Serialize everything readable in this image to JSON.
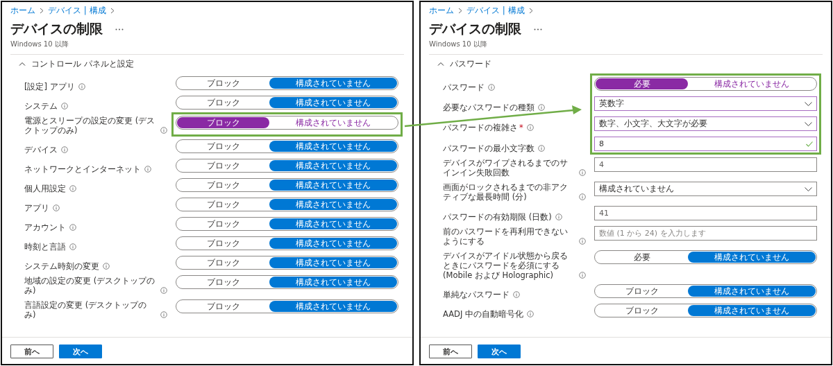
{
  "panels": [
    {
      "breadcrumb": [
        "ホーム",
        "デバイス | 構成"
      ],
      "title": "デバイスの制限",
      "subtitle": "Windows 10 以降",
      "section": {
        "label": "コントロール パネルと設定",
        "expanded": true
      },
      "settings": [
        {
          "kind": "toggle",
          "label": "[設定] アプリ",
          "highlighted": false,
          "options": [
            {
              "label": "ブロック",
              "selected": false
            },
            {
              "label": "構成されていません",
              "selected": true
            }
          ]
        },
        {
          "kind": "toggle",
          "label": "システム",
          "highlighted": false,
          "options": [
            {
              "label": "ブロック",
              "selected": false
            },
            {
              "label": "構成されていません",
              "selected": true
            }
          ]
        },
        {
          "kind": "toggle",
          "label": "電源とスリープの設定の変更 (デスクトップのみ)",
          "highlighted": true,
          "options": [
            {
              "label": "ブロック",
              "selected": true
            },
            {
              "label": "構成されていません",
              "selected": false
            }
          ]
        },
        {
          "kind": "toggle",
          "label": "デバイス",
          "highlighted": false,
          "options": [
            {
              "label": "ブロック",
              "selected": false
            },
            {
              "label": "構成されていません",
              "selected": true
            }
          ]
        },
        {
          "kind": "toggle",
          "label": "ネットワークとインターネット",
          "highlighted": false,
          "options": [
            {
              "label": "ブロック",
              "selected": false
            },
            {
              "label": "構成されていません",
              "selected": true
            }
          ]
        },
        {
          "kind": "toggle",
          "label": "個人用設定",
          "highlighted": false,
          "options": [
            {
              "label": "ブロック",
              "selected": false
            },
            {
              "label": "構成されていません",
              "selected": true
            }
          ]
        },
        {
          "kind": "toggle",
          "label": "アプリ",
          "highlighted": false,
          "options": [
            {
              "label": "ブロック",
              "selected": false
            },
            {
              "label": "構成されていません",
              "selected": true
            }
          ]
        },
        {
          "kind": "toggle",
          "label": "アカウント",
          "highlighted": false,
          "options": [
            {
              "label": "ブロック",
              "selected": false
            },
            {
              "label": "構成されていません",
              "selected": true
            }
          ]
        },
        {
          "kind": "toggle",
          "label": "時刻と言語",
          "highlighted": false,
          "options": [
            {
              "label": "ブロック",
              "selected": false
            },
            {
              "label": "構成されていません",
              "selected": true
            }
          ]
        },
        {
          "kind": "toggle",
          "label": "システム時刻の変更",
          "highlighted": false,
          "options": [
            {
              "label": "ブロック",
              "selected": false
            },
            {
              "label": "構成されていません",
              "selected": true
            }
          ]
        },
        {
          "kind": "toggle",
          "label": "地域の設定の変更 (デスクトップのみ)",
          "highlighted": false,
          "options": [
            {
              "label": "ブロック",
              "selected": false
            },
            {
              "label": "構成されていません",
              "selected": true
            }
          ]
        },
        {
          "kind": "toggle",
          "label": "言語設定の変更 (デスクトップのみ)",
          "highlighted": false,
          "options": [
            {
              "label": "ブロック",
              "selected": false
            },
            {
              "label": "構成されていません",
              "selected": true
            }
          ]
        }
      ],
      "buttons": [
        {
          "label": "前へ",
          "kind": "secondary"
        },
        {
          "label": "次へ",
          "kind": "primary"
        }
      ]
    },
    {
      "breadcrumb": [
        "ホーム",
        "デバイス | 構成"
      ],
      "title": "デバイスの制限",
      "subtitle": "Windows 10 以降",
      "section": {
        "label": "パスワード",
        "expanded": true
      },
      "settings": [
        {
          "kind": "toggle",
          "label": "パスワード",
          "highlighted": true,
          "options": [
            {
              "label": "必要",
              "selected": true
            },
            {
              "label": "構成されていません",
              "selected": false
            }
          ]
        },
        {
          "kind": "dropdown",
          "label": "必要なパスワードの種類",
          "highlighted": true,
          "value": "英数字"
        },
        {
          "kind": "dropdown",
          "label": "パスワードの複雑さ",
          "required_mark": "*",
          "highlighted": true,
          "value": "数字、小文字、大文字が必要"
        },
        {
          "kind": "input",
          "label": "パスワードの最小文字数",
          "highlighted": true,
          "value": "8",
          "valid": true
        },
        {
          "kind": "input",
          "label": "デバイスがワイプされるまでのサインイン失敗回数",
          "highlighted": false,
          "value": "4",
          "valid": false
        },
        {
          "kind": "dropdown",
          "label": "画面がロックされるまでの非アクティブな最長時間 (分)",
          "highlighted": false,
          "value": "構成されていません"
        },
        {
          "kind": "input",
          "label": "パスワードの有効期限 (日数)",
          "highlighted": false,
          "value": "41",
          "valid": false
        },
        {
          "kind": "input",
          "label": "前のパスワードを再利用できないようにする",
          "highlighted": false,
          "placeholder": "数値 (1 から 24) を入力します",
          "valid": false
        },
        {
          "kind": "toggle",
          "label": "デバイスがアイドル状態から戻るときにパスワードを必須にする (Mobile および Holographic)",
          "highlighted": false,
          "options": [
            {
              "label": "必要",
              "selected": false
            },
            {
              "label": "構成されていません",
              "selected": true
            }
          ]
        },
        {
          "kind": "toggle",
          "label": "単純なパスワード",
          "highlighted": false,
          "options": [
            {
              "label": "ブロック",
              "selected": false
            },
            {
              "label": "構成されていません",
              "selected": true
            }
          ]
        },
        {
          "kind": "toggle",
          "label": "AADJ 中の自動暗号化",
          "highlighted": false,
          "options": [
            {
              "label": "ブロック",
              "selected": false
            },
            {
              "label": "構成されていません",
              "selected": true
            }
          ]
        }
      ],
      "buttons": [
        {
          "label": "前へ",
          "kind": "secondary"
        },
        {
          "label": "次へ",
          "kind": "primary"
        }
      ]
    }
  ],
  "callout_arrow": true
}
